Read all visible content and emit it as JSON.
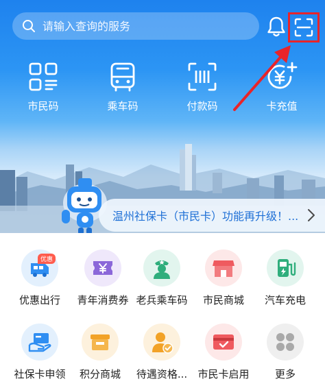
{
  "search": {
    "placeholder": "请输入查询的服务"
  },
  "quick_actions": [
    {
      "label": "市民码",
      "icon": "citizen-qr-icon"
    },
    {
      "label": "乘车码",
      "icon": "bus-icon"
    },
    {
      "label": "付款码",
      "icon": "payment-barcode-icon"
    },
    {
      "label": "卡充值",
      "icon": "card-recharge-icon"
    }
  ],
  "banner": {
    "text": "温州社保卡（市民卡）功能再升级！..."
  },
  "services_row1": [
    {
      "label": "优惠出行",
      "badge": "优惠",
      "icon": "discount-travel-icon",
      "bg": "#e3f0fd",
      "color": "#2f8ef2"
    },
    {
      "label": "青年消费券",
      "icon": "youth-coupon-icon",
      "bg": "#efe8fb",
      "color": "#8b67d9"
    },
    {
      "label": "老兵乘车码",
      "icon": "veteran-icon",
      "bg": "#e2f5ee",
      "color": "#2fae7c"
    },
    {
      "label": "市民商城",
      "icon": "mall-icon",
      "bg": "#fde8e8",
      "color": "#ef5a5f"
    },
    {
      "label": "汽车充电",
      "icon": "ev-charging-icon",
      "bg": "#e2f5ee",
      "color": "#2fae7c"
    }
  ],
  "services_row2": [
    {
      "label": "社保卡申领",
      "icon": "social-card-apply-icon",
      "bg": "#e3f0fd",
      "color": "#2f8ef2"
    },
    {
      "label": "积分商城",
      "icon": "points-mall-icon",
      "bg": "#fdf1dd",
      "color": "#f2a227"
    },
    {
      "label": "待遇资格...",
      "icon": "qualification-icon",
      "bg": "#fdf1dd",
      "color": "#f2a227"
    },
    {
      "label": "市民卡启用",
      "icon": "card-activate-icon",
      "bg": "#fde8e8",
      "color": "#ef5a5f"
    },
    {
      "label": "更多",
      "icon": "more-icon",
      "bg": "#efefef",
      "color": "#a9a9a9"
    }
  ],
  "annotation_color": "#e8242a"
}
